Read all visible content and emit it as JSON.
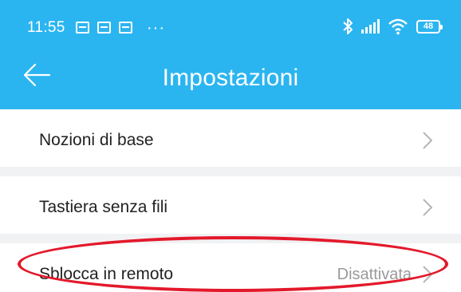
{
  "status_bar": {
    "time": "11:55",
    "left_icons": [
      "notification-icon",
      "vpn-icon",
      "calendar-icon"
    ],
    "overflow": "···",
    "right_icons": [
      "bluetooth-icon",
      "signal-icon",
      "wifi-icon"
    ],
    "battery_level": "48"
  },
  "app_bar": {
    "title": "Impostazioni",
    "back_icon": "back-arrow-icon",
    "color": "#2bb5f0"
  },
  "settings": {
    "items": [
      {
        "label": "Nozioni di base",
        "value": ""
      },
      {
        "label": "Tastiera senza fili",
        "value": ""
      },
      {
        "label": "Sblocca in remoto",
        "value": "Disattivata"
      }
    ]
  },
  "annotation": {
    "color": "#e3192b",
    "shape": "ellipse"
  }
}
